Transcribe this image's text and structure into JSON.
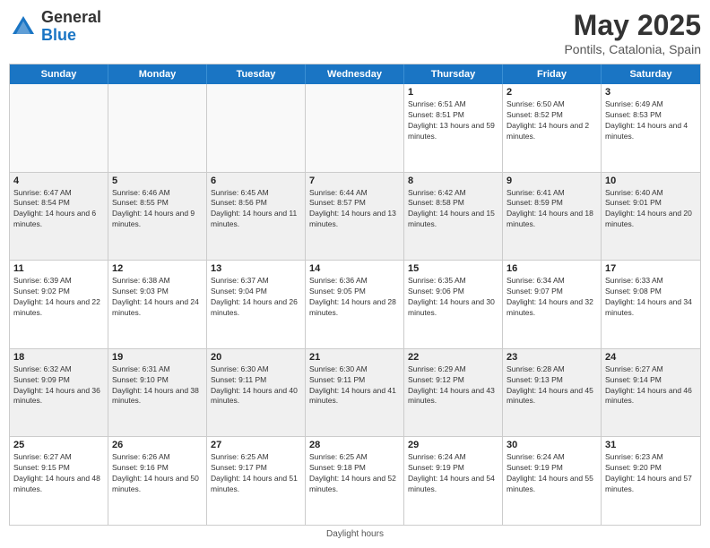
{
  "logo": {
    "general": "General",
    "blue": "Blue"
  },
  "title": "May 2025",
  "subtitle": "Pontils, Catalonia, Spain",
  "days": [
    "Sunday",
    "Monday",
    "Tuesday",
    "Wednesday",
    "Thursday",
    "Friday",
    "Saturday"
  ],
  "footer": "Daylight hours",
  "weeks": [
    [
      {
        "num": "",
        "sunrise": "",
        "sunset": "",
        "daylight": "",
        "empty": true
      },
      {
        "num": "",
        "sunrise": "",
        "sunset": "",
        "daylight": "",
        "empty": true
      },
      {
        "num": "",
        "sunrise": "",
        "sunset": "",
        "daylight": "",
        "empty": true
      },
      {
        "num": "",
        "sunrise": "",
        "sunset": "",
        "daylight": "",
        "empty": true
      },
      {
        "num": "1",
        "sunrise": "Sunrise: 6:51 AM",
        "sunset": "Sunset: 8:51 PM",
        "daylight": "Daylight: 13 hours and 59 minutes.",
        "empty": false
      },
      {
        "num": "2",
        "sunrise": "Sunrise: 6:50 AM",
        "sunset": "Sunset: 8:52 PM",
        "daylight": "Daylight: 14 hours and 2 minutes.",
        "empty": false
      },
      {
        "num": "3",
        "sunrise": "Sunrise: 6:49 AM",
        "sunset": "Sunset: 8:53 PM",
        "daylight": "Daylight: 14 hours and 4 minutes.",
        "empty": false
      }
    ],
    [
      {
        "num": "4",
        "sunrise": "Sunrise: 6:47 AM",
        "sunset": "Sunset: 8:54 PM",
        "daylight": "Daylight: 14 hours and 6 minutes.",
        "empty": false
      },
      {
        "num": "5",
        "sunrise": "Sunrise: 6:46 AM",
        "sunset": "Sunset: 8:55 PM",
        "daylight": "Daylight: 14 hours and 9 minutes.",
        "empty": false
      },
      {
        "num": "6",
        "sunrise": "Sunrise: 6:45 AM",
        "sunset": "Sunset: 8:56 PM",
        "daylight": "Daylight: 14 hours and 11 minutes.",
        "empty": false
      },
      {
        "num": "7",
        "sunrise": "Sunrise: 6:44 AM",
        "sunset": "Sunset: 8:57 PM",
        "daylight": "Daylight: 14 hours and 13 minutes.",
        "empty": false
      },
      {
        "num": "8",
        "sunrise": "Sunrise: 6:42 AM",
        "sunset": "Sunset: 8:58 PM",
        "daylight": "Daylight: 14 hours and 15 minutes.",
        "empty": false
      },
      {
        "num": "9",
        "sunrise": "Sunrise: 6:41 AM",
        "sunset": "Sunset: 8:59 PM",
        "daylight": "Daylight: 14 hours and 18 minutes.",
        "empty": false
      },
      {
        "num": "10",
        "sunrise": "Sunrise: 6:40 AM",
        "sunset": "Sunset: 9:01 PM",
        "daylight": "Daylight: 14 hours and 20 minutes.",
        "empty": false
      }
    ],
    [
      {
        "num": "11",
        "sunrise": "Sunrise: 6:39 AM",
        "sunset": "Sunset: 9:02 PM",
        "daylight": "Daylight: 14 hours and 22 minutes.",
        "empty": false
      },
      {
        "num": "12",
        "sunrise": "Sunrise: 6:38 AM",
        "sunset": "Sunset: 9:03 PM",
        "daylight": "Daylight: 14 hours and 24 minutes.",
        "empty": false
      },
      {
        "num": "13",
        "sunrise": "Sunrise: 6:37 AM",
        "sunset": "Sunset: 9:04 PM",
        "daylight": "Daylight: 14 hours and 26 minutes.",
        "empty": false
      },
      {
        "num": "14",
        "sunrise": "Sunrise: 6:36 AM",
        "sunset": "Sunset: 9:05 PM",
        "daylight": "Daylight: 14 hours and 28 minutes.",
        "empty": false
      },
      {
        "num": "15",
        "sunrise": "Sunrise: 6:35 AM",
        "sunset": "Sunset: 9:06 PM",
        "daylight": "Daylight: 14 hours and 30 minutes.",
        "empty": false
      },
      {
        "num": "16",
        "sunrise": "Sunrise: 6:34 AM",
        "sunset": "Sunset: 9:07 PM",
        "daylight": "Daylight: 14 hours and 32 minutes.",
        "empty": false
      },
      {
        "num": "17",
        "sunrise": "Sunrise: 6:33 AM",
        "sunset": "Sunset: 9:08 PM",
        "daylight": "Daylight: 14 hours and 34 minutes.",
        "empty": false
      }
    ],
    [
      {
        "num": "18",
        "sunrise": "Sunrise: 6:32 AM",
        "sunset": "Sunset: 9:09 PM",
        "daylight": "Daylight: 14 hours and 36 minutes.",
        "empty": false
      },
      {
        "num": "19",
        "sunrise": "Sunrise: 6:31 AM",
        "sunset": "Sunset: 9:10 PM",
        "daylight": "Daylight: 14 hours and 38 minutes.",
        "empty": false
      },
      {
        "num": "20",
        "sunrise": "Sunrise: 6:30 AM",
        "sunset": "Sunset: 9:11 PM",
        "daylight": "Daylight: 14 hours and 40 minutes.",
        "empty": false
      },
      {
        "num": "21",
        "sunrise": "Sunrise: 6:30 AM",
        "sunset": "Sunset: 9:11 PM",
        "daylight": "Daylight: 14 hours and 41 minutes.",
        "empty": false
      },
      {
        "num": "22",
        "sunrise": "Sunrise: 6:29 AM",
        "sunset": "Sunset: 9:12 PM",
        "daylight": "Daylight: 14 hours and 43 minutes.",
        "empty": false
      },
      {
        "num": "23",
        "sunrise": "Sunrise: 6:28 AM",
        "sunset": "Sunset: 9:13 PM",
        "daylight": "Daylight: 14 hours and 45 minutes.",
        "empty": false
      },
      {
        "num": "24",
        "sunrise": "Sunrise: 6:27 AM",
        "sunset": "Sunset: 9:14 PM",
        "daylight": "Daylight: 14 hours and 46 minutes.",
        "empty": false
      }
    ],
    [
      {
        "num": "25",
        "sunrise": "Sunrise: 6:27 AM",
        "sunset": "Sunset: 9:15 PM",
        "daylight": "Daylight: 14 hours and 48 minutes.",
        "empty": false
      },
      {
        "num": "26",
        "sunrise": "Sunrise: 6:26 AM",
        "sunset": "Sunset: 9:16 PM",
        "daylight": "Daylight: 14 hours and 50 minutes.",
        "empty": false
      },
      {
        "num": "27",
        "sunrise": "Sunrise: 6:25 AM",
        "sunset": "Sunset: 9:17 PM",
        "daylight": "Daylight: 14 hours and 51 minutes.",
        "empty": false
      },
      {
        "num": "28",
        "sunrise": "Sunrise: 6:25 AM",
        "sunset": "Sunset: 9:18 PM",
        "daylight": "Daylight: 14 hours and 52 minutes.",
        "empty": false
      },
      {
        "num": "29",
        "sunrise": "Sunrise: 6:24 AM",
        "sunset": "Sunset: 9:19 PM",
        "daylight": "Daylight: 14 hours and 54 minutes.",
        "empty": false
      },
      {
        "num": "30",
        "sunrise": "Sunrise: 6:24 AM",
        "sunset": "Sunset: 9:19 PM",
        "daylight": "Daylight: 14 hours and 55 minutes.",
        "empty": false
      },
      {
        "num": "31",
        "sunrise": "Sunrise: 6:23 AM",
        "sunset": "Sunset: 9:20 PM",
        "daylight": "Daylight: 14 hours and 57 minutes.",
        "empty": false
      }
    ]
  ]
}
